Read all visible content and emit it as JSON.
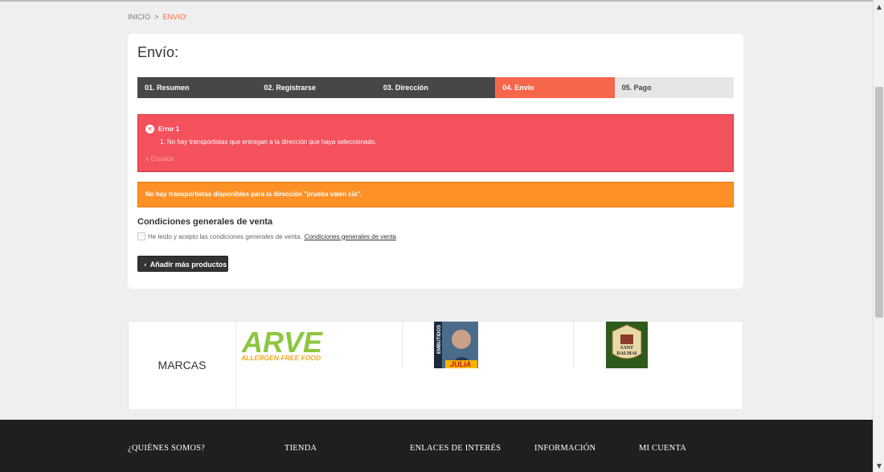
{
  "breadcrumb": {
    "home": "INICIO",
    "separator": ">",
    "current": "ENVIO:"
  },
  "page": {
    "title": "Envío:"
  },
  "steps": [
    {
      "label": "01. Resumen",
      "state": "done"
    },
    {
      "label": "02. Registrarse",
      "state": "done"
    },
    {
      "label": "03. Dirección",
      "state": "done"
    },
    {
      "label": "04. Envio",
      "state": "active"
    },
    {
      "label": "05. Pago",
      "state": "todo"
    }
  ],
  "error": {
    "title": "Error 1",
    "items": [
      "1.   No hay transportistas que entregan a la dirección que haya seleccionado."
    ],
    "back_link": "« Espalda"
  },
  "warning": {
    "text": "No hay transportistas disponibles para la dirección \"prueba valen cia\"."
  },
  "terms": {
    "title": "Condiciones generales de venta",
    "checkbox_label": "He leído y acepto las condiciones generales de venta.",
    "link": "Condiciones generales de venta",
    "checked": false
  },
  "buttons": {
    "add_more": "Añadir más productos"
  },
  "brands": {
    "label": "MARCAS",
    "logos": [
      {
        "name": "ARVE",
        "tagline": "ALLERGEN-FREE FOOD"
      },
      {
        "name": "Embutidos Julià",
        "top": "EMBUTIDOS",
        "bottom": "JULIA"
      },
      {
        "name": "Sant Dalmai",
        "top": "SANT",
        "bottom": "DALMAI"
      }
    ]
  },
  "footer": {
    "columns": [
      "¿QUIÉNES SOMOS?",
      "TIENDA",
      "ENLACES DE INTERÉS",
      "INFORMACIÓN",
      "MI CUENTA"
    ]
  },
  "colors": {
    "accent": "#f5664b",
    "step_dark": "#474747",
    "error_bg": "#f3515c",
    "warning_bg": "#fe9126",
    "footer_bg": "#1f1f1f"
  }
}
